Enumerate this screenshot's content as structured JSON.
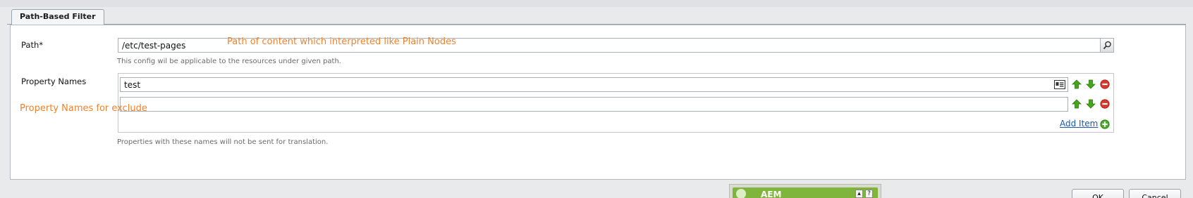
{
  "tabs": [
    {
      "label": "Path-Based Filter"
    }
  ],
  "path_field": {
    "label": "Path*",
    "value": "/etc/test-pages",
    "hint": "This config wil be applicable to the resources under given path.",
    "trigger_icon": "search-icon"
  },
  "property_names": {
    "label": "Property Names",
    "items": [
      {
        "value": "test",
        "picker_icon": "id-card-icon"
      },
      {
        "value": ""
      }
    ],
    "add_item_label": "Add Item",
    "hint": "Properties with these names will not be sent for translation."
  },
  "annotations": {
    "path_note": "Path of content which interpreted like Plain Nodes",
    "property_note": "Property Names for exclude"
  },
  "buttons": {
    "ok": "OK",
    "cancel": "Cancel"
  },
  "taskbar": {
    "title": "AEM"
  },
  "colors": {
    "annotation": "#f0822d",
    "move_up": "#45a51c",
    "move_down": "#45a51c",
    "remove": "#d9372b",
    "add": "#4aa82a",
    "link": "#1b5aa8",
    "aem_green": "#7fb43d"
  }
}
